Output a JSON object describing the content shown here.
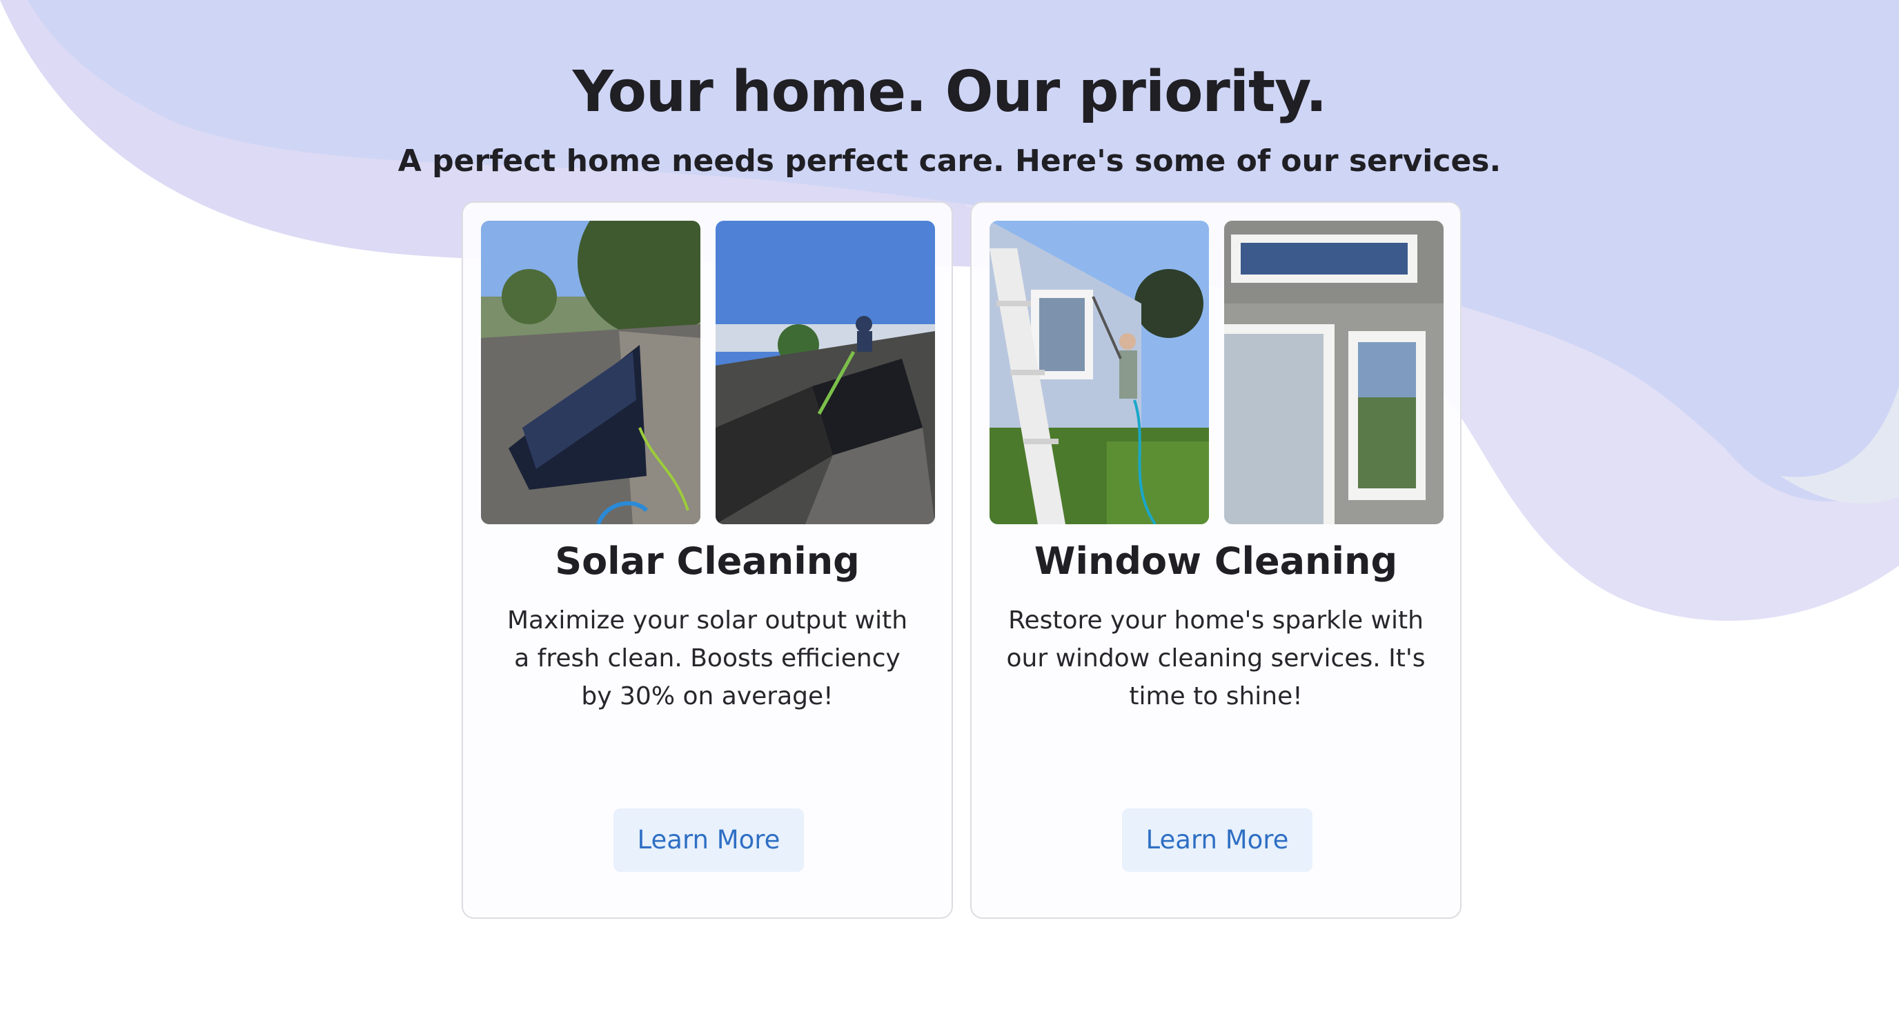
{
  "hero": {
    "title": "Your home. Our priority.",
    "subtitle": "A perfect home needs perfect care. Here's some of our services."
  },
  "services": [
    {
      "title": "Solar Cleaning",
      "description": "Maximize your solar output with a fresh clean. Boosts efficiency by 30% on average!",
      "button_label": "Learn More"
    },
    {
      "title": "Window Cleaning",
      "description": "Restore your home's sparkle with our window cleaning services. It's time to shine!",
      "button_label": "Learn More"
    }
  ],
  "colors": {
    "background_wave_primary": "#cdd3f4",
    "background_wave_secondary": "#dcdaf4",
    "button_background": "#e8f1fc",
    "button_text": "#2f6fc4",
    "card_border": "#dcdce2",
    "heading_text": "#1f1f24"
  }
}
